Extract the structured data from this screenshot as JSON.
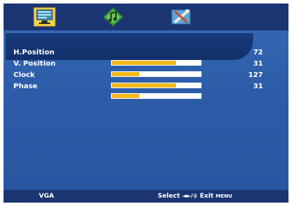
{
  "tabs": [
    {
      "name": "picture-tab",
      "icon": "monitor-icon",
      "active": true
    },
    {
      "name": "sound-tab",
      "icon": "music-note-icon",
      "active": false
    },
    {
      "name": "setup-tab",
      "icon": "wrench-screwdriver-icon",
      "active": false
    }
  ],
  "settings": [
    {
      "label": "H.Position",
      "value": "72",
      "level": 0.72
    },
    {
      "label": "V. Position",
      "value": "31",
      "level": 0.31
    },
    {
      "label": "Clock",
      "value": "127",
      "level": 0.72
    },
    {
      "label": "Phase",
      "value": "31",
      "level": 0.31
    }
  ],
  "footer": {
    "source": "VGA",
    "select_label": "Select",
    "nav_symbols": "◄►/≑",
    "exit_label": "Exit",
    "menu_label": "MENU"
  },
  "colors": {
    "panel": "#2c5ca8",
    "highlight": "#12306a",
    "bar_fill": "#f2b81c",
    "bar_track": "#ffffff"
  }
}
